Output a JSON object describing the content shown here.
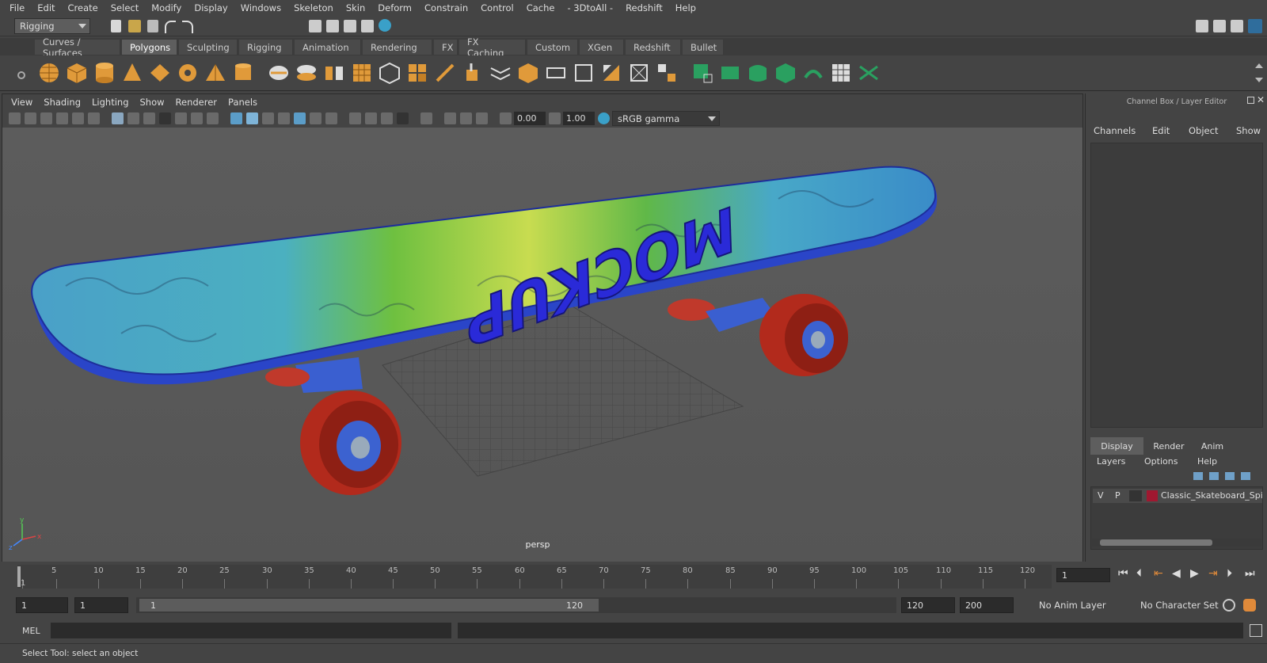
{
  "menu": [
    "File",
    "Edit",
    "Create",
    "Select",
    "Modify",
    "Display",
    "Windows",
    "Skeleton",
    "Skin",
    "Deform",
    "Constrain",
    "Control",
    "Cache",
    "- 3DtoAll -",
    "Redshift",
    "Help"
  ],
  "mode_selector": {
    "value": "Rigging"
  },
  "shelf_tabs": [
    "Curves / Surfaces",
    "Polygons",
    "Sculpting",
    "Rigging",
    "Animation",
    "Rendering",
    "FX",
    "FX Caching",
    "Custom",
    "XGen",
    "Redshift",
    "Bullet"
  ],
  "shelf_active": "Polygons",
  "viewport": {
    "menu": [
      "View",
      "Shading",
      "Lighting",
      "Show",
      "Renderer",
      "Panels"
    ],
    "exposure": "0.00",
    "gamma": "1.00",
    "color_space": "sRGB gamma",
    "camera_label": "persp",
    "deck_text": "MOCKUP",
    "axis_y": "y",
    "axis_x": "x",
    "axis_z": "z"
  },
  "channel_box": {
    "title": "Channel Box / Layer Editor",
    "menu": [
      "Channels",
      "Edit",
      "Object",
      "Show"
    ]
  },
  "layer_editor": {
    "tabs": [
      "Display",
      "Render",
      "Anim"
    ],
    "active_tab": "Display",
    "menu": [
      "Layers",
      "Options",
      "Help"
    ],
    "layer": {
      "v": "V",
      "p": "P",
      "name": "Classic_Skateboard_Spitf",
      "color": "#a01830"
    }
  },
  "timeline": {
    "ticks": [
      "1",
      "5",
      "10",
      "15",
      "20",
      "25",
      "30",
      "35",
      "40",
      "45",
      "50",
      "55",
      "60",
      "65",
      "70",
      "75",
      "80",
      "85",
      "90",
      "95",
      "100",
      "105",
      "110",
      "115",
      "120"
    ],
    "current_frame": "1"
  },
  "range": {
    "start": "1",
    "playback_start": "1",
    "slider_start": "1",
    "slider_end": "120",
    "playback_end": "120",
    "end": "200",
    "anim_layer": "No Anim Layer",
    "character_set": "No Character Set"
  },
  "command": {
    "label": "MEL"
  },
  "help_line": "Select Tool: select an object"
}
